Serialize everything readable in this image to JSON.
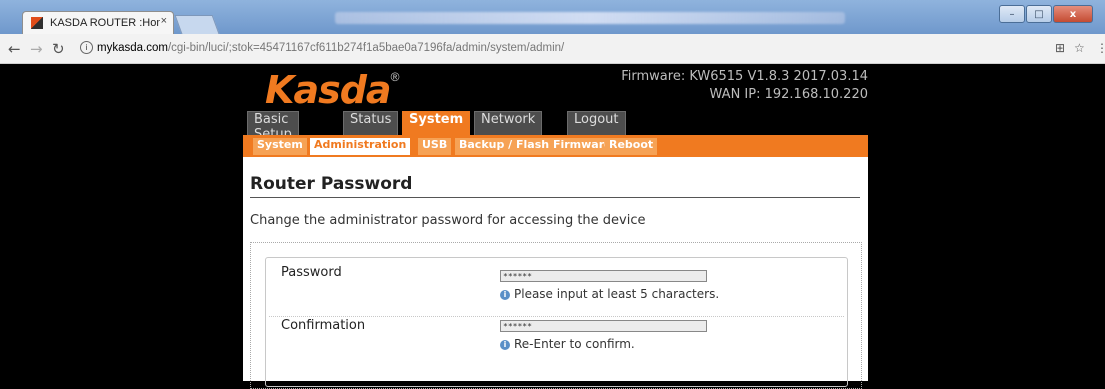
{
  "browser": {
    "tab_title": "KASDA ROUTER :Home",
    "tab_close": "×",
    "url_host": "mykasda.com",
    "url_path": "/cgi-bin/luci/;stok=45471167cf611b274f1a5bae0a7196fa/admin/system/admin/",
    "window_controls": {
      "minimize": "–",
      "maximize": "□",
      "close": "x"
    }
  },
  "router": {
    "logo_text": "Kasda",
    "logo_mark": "®",
    "firmware": "Firmware: KW6515 V1.8.3 2017.03.14",
    "wan_ip": "WAN IP: 192.168.10.220",
    "main_tabs": [
      "Basic Setup",
      "Status",
      "System",
      "Network",
      "Logout"
    ],
    "active_main_tab": "System",
    "sub_tabs": [
      "System",
      "Administration",
      "USB",
      "Backup / Flash Firmware",
      "Reboot"
    ],
    "active_sub_tab": "Administration",
    "accent_color": "#f07a20"
  },
  "form": {
    "heading": "Router Password",
    "description": "Change the administrator password for accessing the device",
    "password_label": "Password",
    "password_value": "******",
    "password_hint": "Please input at least 5 characters.",
    "confirm_label": "Confirmation",
    "confirm_value": "******",
    "confirm_hint": "Re-Enter to confirm."
  }
}
